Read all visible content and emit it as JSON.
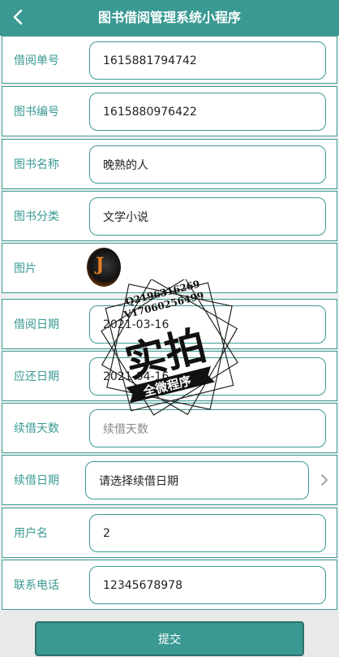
{
  "header": {
    "title": "图书借阅管理系统小程序",
    "back_icon": "chevron-left-icon"
  },
  "form": {
    "borrow_no": {
      "label": "借阅单号",
      "value": "1615881794742"
    },
    "book_no": {
      "label": "图书编号",
      "value": "1615880976422"
    },
    "book_name": {
      "label": "图书名称",
      "value": "晚熟的人"
    },
    "book_category": {
      "label": "图书分类",
      "value": "文学小说"
    },
    "image": {
      "label": "图片"
    },
    "borrow_date": {
      "label": "借阅日期",
      "value": "2021-03-16"
    },
    "due_date": {
      "label": "应还日期",
      "value": "2021-04-16"
    },
    "renew_days": {
      "label": "续借天数",
      "placeholder": "续借天数"
    },
    "renew_date": {
      "label": "续借日期",
      "placeholder": "请选择续借日期"
    },
    "username": {
      "label": "用户名",
      "value": "2"
    },
    "phone": {
      "label": "联系电话",
      "value": "12345678978"
    }
  },
  "submit_label": "提交",
  "watermark": {
    "line1": "Q2196316269",
    "line2": "V17060256499",
    "big": "实拍",
    "banner": "全微程序"
  },
  "colors": {
    "primary": "#3a9a93",
    "background": "#f0f0f0"
  }
}
